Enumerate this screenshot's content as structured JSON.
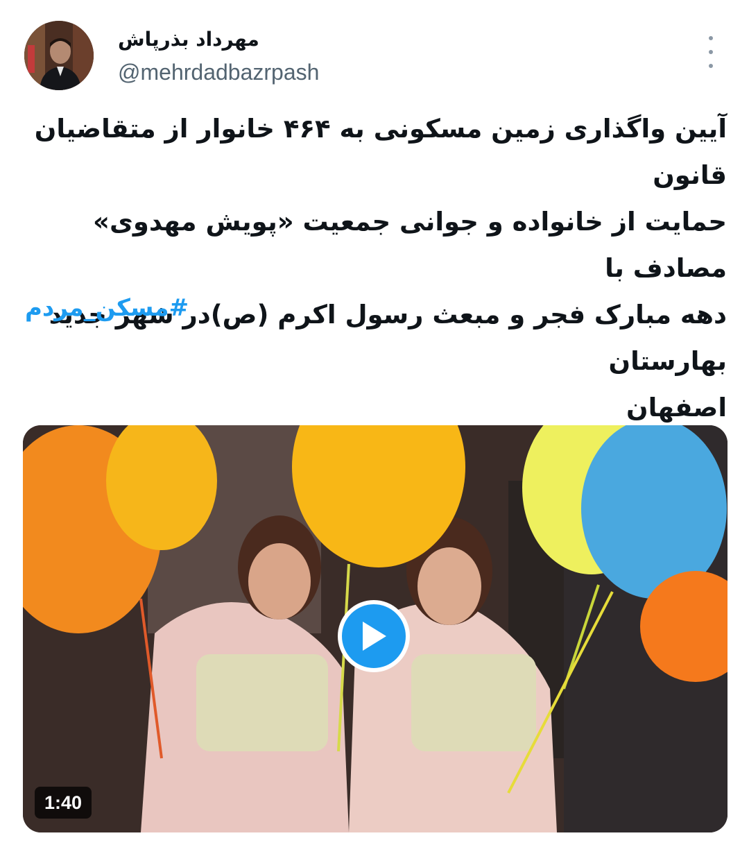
{
  "author": {
    "display_name": "مهرداد بذرپاش",
    "handle": "@mehrdadbazrpash",
    "avatar_icon": "profile-photo"
  },
  "tweet": {
    "text_lines": [
      "آیین واگذاری زمین مسکونی به ۴۶۴ خانوار از متقاضیان قانون",
      "حمایت از خانواده و جوانی جمعیت «پویش مهدوی» مصادف با",
      "دهه مبارک فجر و مبعث رسول اکرم (ص)در شهر جدید بهارستان",
      "اصفهان"
    ],
    "hashtag": "#مسکن_مردم"
  },
  "media": {
    "type": "video",
    "duration": "1:40",
    "play_icon": "play-icon"
  },
  "colors": {
    "accent": "#1d9bf0",
    "text": "#0f1419",
    "secondary": "#536471"
  }
}
